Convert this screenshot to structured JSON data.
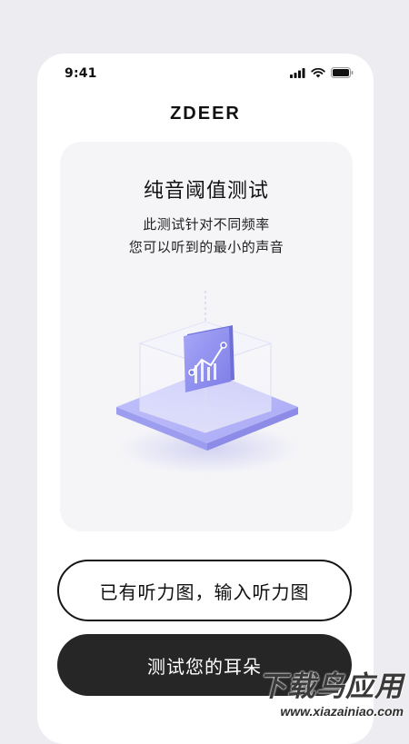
{
  "status_bar": {
    "time": "9:41",
    "icons": [
      "cellular-signal-icon",
      "wifi-icon",
      "battery-icon"
    ]
  },
  "header": {
    "brand": "ZDEER"
  },
  "card": {
    "title": "纯音阈值测试",
    "subtitle_line1": "此测试针对不同频率",
    "subtitle_line2": "您可以听到的最小的声音",
    "illustration": "audiogram-chart-cube-illustration"
  },
  "buttons": {
    "input_audiogram": "已有听力图，输入听力图",
    "test_ears": "测试您的耳朵"
  },
  "watermark": {
    "cn": "下载鸟应用",
    "en": "www.xiazainiao.com"
  },
  "colors": {
    "background": "#ededf1",
    "card": "#f5f5f8",
    "primary_dark": "#262626",
    "illustration_accent": "#8f8ff0"
  }
}
